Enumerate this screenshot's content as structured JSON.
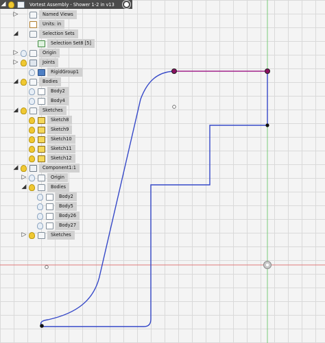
{
  "browser": {
    "title": "Vortest Assembly - Shower 1-2 in v13",
    "nodes": [
      {
        "id": "named-views",
        "arrow": "▷",
        "bulb": "none",
        "icon": "folder",
        "label": "Named Views"
      },
      {
        "id": "units",
        "arrow": "",
        "bulb": "none",
        "icon": "units",
        "label": "Units: in"
      },
      {
        "id": "selection-sets",
        "arrow": "◢",
        "bulb": "none",
        "icon": "folder",
        "label": "Selection Sets"
      },
      {
        "id": "selection-set8",
        "arrow": "",
        "bulb": "none",
        "icon": "selset",
        "label": "Selection Set8 [5]"
      },
      {
        "id": "origin",
        "arrow": "▷",
        "bulb": "off",
        "icon": "folder",
        "label": "Origin"
      },
      {
        "id": "joints",
        "arrow": "▷",
        "bulb": "on",
        "icon": "joint",
        "label": "Joints"
      },
      {
        "id": "rigidgroup1",
        "arrow": "",
        "bulb": "off",
        "icon": "rigid",
        "label": "RigidGroup1"
      },
      {
        "id": "bodies",
        "arrow": "◢",
        "bulb": "on",
        "icon": "folder",
        "label": "Bodies"
      },
      {
        "id": "body2",
        "arrow": "",
        "bulb": "off",
        "icon": "body",
        "label": "Body2"
      },
      {
        "id": "body4",
        "arrow": "",
        "bulb": "off",
        "icon": "body",
        "label": "Body4"
      },
      {
        "id": "sketches",
        "arrow": "◢",
        "bulb": "on",
        "icon": "folder",
        "label": "Sketches"
      },
      {
        "id": "sketch8",
        "arrow": "",
        "bulb": "on",
        "icon": "sketch",
        "label": "Sketch8"
      },
      {
        "id": "sketch9",
        "arrow": "",
        "bulb": "on",
        "icon": "sketch",
        "label": "Sketch9"
      },
      {
        "id": "sketch10",
        "arrow": "",
        "bulb": "on",
        "icon": "sketch",
        "label": "Sketch10"
      },
      {
        "id": "sketch11",
        "arrow": "",
        "bulb": "on",
        "icon": "sketch",
        "label": "Sketch11"
      },
      {
        "id": "sketch12",
        "arrow": "",
        "bulb": "on",
        "icon": "sketch",
        "label": "Sketch12"
      },
      {
        "id": "component1",
        "arrow": "◢",
        "bulb": "on",
        "icon": "comp",
        "label": "Component1:1"
      },
      {
        "id": "comp-origin",
        "arrow": "▷",
        "bulb": "off",
        "icon": "folder",
        "label": "Origin"
      },
      {
        "id": "comp-bodies",
        "arrow": "◢",
        "bulb": "on",
        "icon": "folder",
        "label": "Bodies"
      },
      {
        "id": "comp-body2",
        "arrow": "",
        "bulb": "off",
        "icon": "body",
        "label": "Body2"
      },
      {
        "id": "comp-body5",
        "arrow": "",
        "bulb": "off",
        "icon": "body",
        "label": "Body5"
      },
      {
        "id": "comp-body26",
        "arrow": "",
        "bulb": "off",
        "icon": "body",
        "label": "Body26"
      },
      {
        "id": "comp-body27",
        "arrow": "",
        "bulb": "off",
        "icon": "body",
        "label": "Body27"
      },
      {
        "id": "comp-sketches",
        "arrow": "▷",
        "bulb": "on",
        "icon": "folder",
        "label": "Sketches"
      }
    ]
  },
  "colors": {
    "header": "#4b4b4b",
    "label_bg": "#d1d1d1",
    "sketch_line": "#3548c8",
    "selected_line": "#a0208a",
    "axis_red": "#e07a7a",
    "axis_green": "#7acc7a"
  }
}
